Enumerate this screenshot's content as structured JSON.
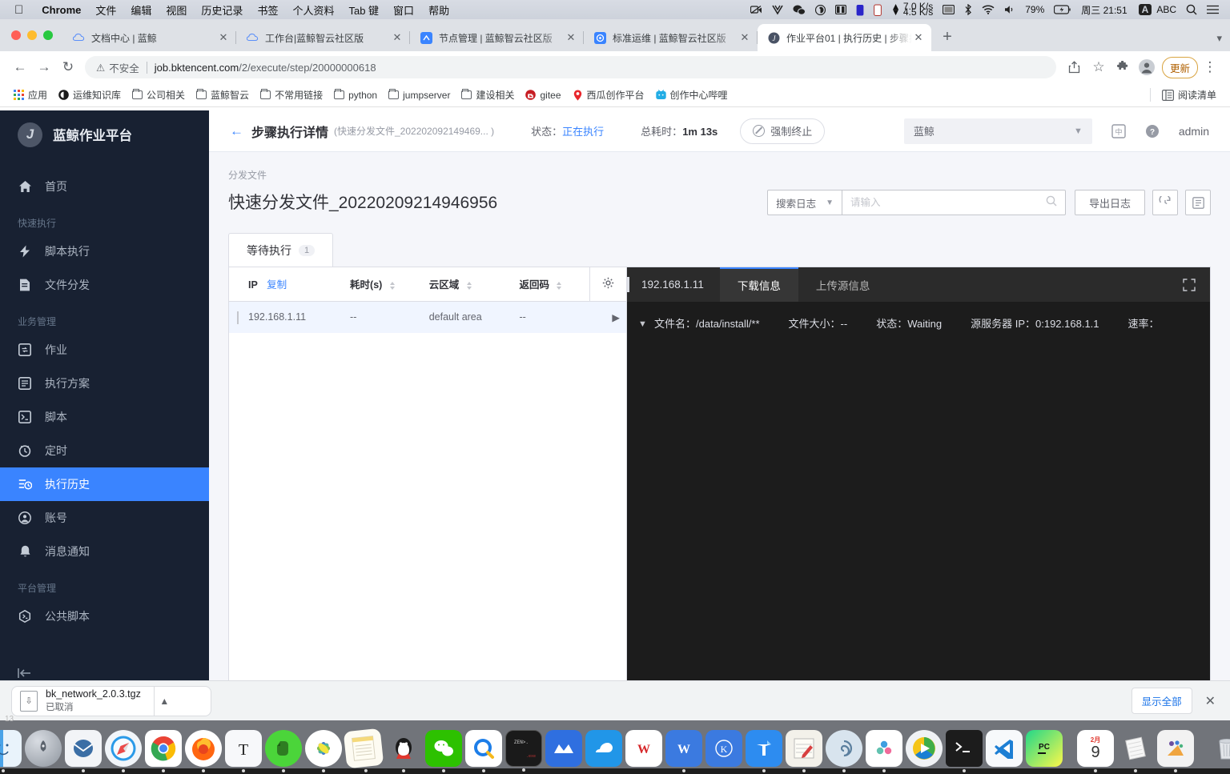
{
  "macos_menubar": {
    "apple_icon": "apple-icon",
    "app_name": "Chrome",
    "items": [
      "文件",
      "编辑",
      "视图",
      "历史记录",
      "书签",
      "个人资料",
      "Tab 键",
      "窗口",
      "帮助"
    ],
    "status": {
      "icons": [
        "screen-record-icon",
        "vivaldi-icon",
        "wechat-icon",
        "airdrop-icon",
        "split-icon",
        "battery-blue-icon",
        "battery-outline-icon"
      ],
      "net_up": "▲ 7.0",
      "net_up_unit": "K/s",
      "net_down": "▼ 4.5",
      "net_down_unit": "K/s",
      "display_icon": "display-icon",
      "bluetooth_icon": "bluetooth-icon",
      "wifi_icon": "wifi-icon",
      "volume_icon": "volume-icon",
      "battery": "79%",
      "battery_icon": "battery-charging-icon",
      "datetime": "周三 21:51",
      "input_badge": "A",
      "input_method": "ABC",
      "search_icon": "spotlight-search-icon",
      "controlcenter_icon": "control-center-icon"
    }
  },
  "browser": {
    "window_buttons": [
      "close",
      "minimize",
      "zoom"
    ],
    "tabs": [
      {
        "title": "文档中心 | 蓝鲸",
        "favicon": "bluking-cloud-icon",
        "active": false
      },
      {
        "title": "工作台|蓝鲸智云社区版",
        "favicon": "bluking-cloud-icon",
        "active": false
      },
      {
        "title": "节点管理 | 蓝鲸智云社区版",
        "favicon": "node-manage-icon",
        "active": false
      },
      {
        "title": "标准运维 | 蓝鲸智云社区版",
        "favicon": "sops-icon",
        "active": false
      },
      {
        "title": "作业平台01 | 执行历史 | 步骤执",
        "favicon": "job-icon",
        "active": true
      }
    ],
    "newtab_label": "+",
    "tabstrip_right_icon": "chevron-down-icon",
    "toolbar": {
      "back_icon": "back-arrow-icon",
      "forward_icon": "forward-arrow-icon",
      "reload_icon": "reload-icon",
      "security_warning": "不安全",
      "url_domain": "job.bktencent.com",
      "url_path": "/2/execute/step/20000000618",
      "share_icon": "share-icon",
      "bookmark_icon": "star-icon",
      "extensions_icon": "puzzle-icon",
      "profile_icon": "profile-avatar-icon",
      "update_label": "更新",
      "menu_icon": "three-dots-icon"
    },
    "bookmarks": [
      {
        "label": "应用",
        "icon": "apps-grid-icon"
      },
      {
        "label": "运维知识库",
        "icon": "black-circle-icon"
      },
      {
        "label": "公司相关",
        "icon": "folder-icon"
      },
      {
        "label": "蓝鲸智云",
        "icon": "folder-icon"
      },
      {
        "label": "不常用链接",
        "icon": "folder-icon"
      },
      {
        "label": "python",
        "icon": "folder-icon"
      },
      {
        "label": "jumpserver",
        "icon": "folder-icon"
      },
      {
        "label": "建设相关",
        "icon": "folder-icon"
      },
      {
        "label": "gitee",
        "icon": "gitee-icon"
      },
      {
        "label": "西瓜创作平台",
        "icon": "location-pin-icon"
      },
      {
        "label": "创作中心哔哩",
        "icon": "bilibili-icon"
      }
    ],
    "reading_list": {
      "label": "阅读清单",
      "icon": "reading-list-icon"
    },
    "downloads": {
      "file_name": "bk_network_2.0.3.tgz",
      "status": "已取消",
      "file_icon": "download-file-icon",
      "chevron_icon": "chevron-up-icon",
      "show_all_label": "显示全部",
      "close_icon": "close-icon"
    }
  },
  "app": {
    "logo": {
      "mark": "J",
      "name": "蓝鲸作业平台"
    },
    "sidebar": {
      "home": {
        "label": "首页",
        "icon": "home-icon"
      },
      "groups": [
        {
          "title": "快速执行",
          "items": [
            {
              "label": "脚本执行",
              "icon": "lightning-script-icon",
              "active": false
            },
            {
              "label": "文件分发",
              "icon": "file-icon",
              "active": false
            }
          ]
        },
        {
          "title": "业务管理",
          "items": [
            {
              "label": "作业",
              "icon": "job-box-icon",
              "active": false
            },
            {
              "label": "执行方案",
              "icon": "plan-icon",
              "active": false
            },
            {
              "label": "脚本",
              "icon": "terminal-icon",
              "active": false
            },
            {
              "label": "定时",
              "icon": "clock-icon",
              "active": false
            },
            {
              "label": "执行历史",
              "icon": "history-icon",
              "active": true
            },
            {
              "label": "账号",
              "icon": "account-icon",
              "active": false
            },
            {
              "label": "消息通知",
              "icon": "bell-icon",
              "active": false
            }
          ]
        },
        {
          "title": "平台管理",
          "items": [
            {
              "label": "公共脚本",
              "icon": "public-script-icon",
              "active": false
            }
          ]
        }
      ],
      "collapse_icon": "collapse-sidebar-icon"
    },
    "header": {
      "back_icon": "back-arrow-icon",
      "title": "步骤执行详情",
      "subtitle": "(快速分发文件_202202092149469... )",
      "status_label": "状态：",
      "status_value": "正在执行",
      "duration_label": "总耗时：",
      "duration_value": "1m 13s",
      "terminate_label": "强制终止",
      "terminate_icon": "forbidden-icon",
      "business_selector": "蓝鲸",
      "business_chevron": "chevron-down-icon",
      "lang_icon": "language-switch-icon",
      "help_icon": "help-circle-icon",
      "user": "admin"
    },
    "content": {
      "breadcrumb": "分发文件",
      "title": "快速分发文件_20220209214946956",
      "search_select": "搜索日志",
      "search_select_chevron": "chevron-down-icon",
      "search_placeholder": "请输入",
      "search_value": "",
      "search_icon": "search-icon",
      "export_label": "导出日志",
      "history_icon": "clock-refresh-icon",
      "list_icon": "list-view-icon",
      "tabs": [
        {
          "label": "等待执行",
          "count": "1",
          "active": true
        }
      ],
      "table": {
        "columns": [
          {
            "label": "IP",
            "link": "复制",
            "sortable": false
          },
          {
            "label": "耗时(s)",
            "sortable": true
          },
          {
            "label": "云区域",
            "sortable": true
          },
          {
            "label": "返回码",
            "sortable": true
          }
        ],
        "gear_icon": "gear-icon",
        "rows": [
          {
            "ip": "192.168.1.11",
            "duration": "--",
            "cloud_area": "default area",
            "return_code": "--",
            "expand_icon": "play-triangle-icon"
          }
        ]
      },
      "log": {
        "ip": "192.168.1.11",
        "tabs": [
          {
            "label": "下载信息",
            "active": true
          },
          {
            "label": "上传源信息",
            "active": false
          }
        ],
        "fullscreen_icon": "fullscreen-icon",
        "caret_icon": "chevron-down-icon",
        "entries": [
          {
            "label": "文件名：",
            "value": "/data/install/**"
          },
          {
            "label": "文件大小：",
            "value": "--"
          },
          {
            "label": "状态：",
            "value": "Waiting"
          },
          {
            "label": "源服务器 IP：",
            "value": "0:192.168.1.1"
          },
          {
            "label": "速率：",
            "value": ""
          }
        ]
      }
    }
  },
  "dock": {
    "left_items": [
      "finder-icon",
      "launchpad-icon",
      "mail-thunderbird-icon",
      "safari-icon",
      "chrome-icon",
      "firefox-icon",
      "typora-icon",
      "evernote-icon",
      "photos-icon",
      "notes-icon",
      "qq-icon",
      "wechat-icon",
      "qq-browser-icon",
      "zen-terminal-icon",
      "mindmaster-icon",
      "seafile-icon"
    ],
    "right_items": [
      "wps-icon",
      "wps-word-icon",
      "kingsoft-icon",
      "tim-icon",
      "onenote-icon",
      "snail-icon",
      "clash-icon",
      "potplayer-icon",
      "terminal-icon",
      "vscode-icon",
      "pycharm-icon"
    ],
    "trailing_items": [
      "calendar-icon",
      "stacks-icon",
      "preview-icon"
    ],
    "trash": "trash-icon",
    "calendar_month": "2月",
    "calendar_day": "9"
  }
}
